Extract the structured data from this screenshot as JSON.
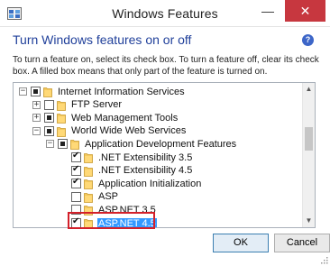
{
  "window": {
    "title": "Windows Features",
    "minimize_glyph": "—",
    "close_glyph": "✕"
  },
  "heading": "Turn Windows features on or off",
  "description": "To turn a feature on, select its check box. To turn a feature off, clear its check box. A filled box means that only part of the feature is turned on.",
  "tree": {
    "items": [
      {
        "label": "Internet Information Services",
        "expander": "−",
        "state": "partial",
        "level": 0
      },
      {
        "label": "FTP Server",
        "expander": "+",
        "state": "unchecked",
        "level": 1
      },
      {
        "label": "Web Management Tools",
        "expander": "+",
        "state": "partial",
        "level": 1
      },
      {
        "label": "World Wide Web Services",
        "expander": "−",
        "state": "partial",
        "level": 1
      },
      {
        "label": "Application Development Features",
        "expander": "−",
        "state": "partial",
        "level": 2
      },
      {
        "label": ".NET Extensibility 3.5",
        "expander": "",
        "state": "checked",
        "level": 3
      },
      {
        "label": ".NET Extensibility 4.5",
        "expander": "",
        "state": "checked",
        "level": 3
      },
      {
        "label": "Application Initialization",
        "expander": "",
        "state": "checked",
        "level": 3
      },
      {
        "label": "ASP",
        "expander": "",
        "state": "unchecked",
        "level": 3
      },
      {
        "label": "ASP.NET 3.5",
        "expander": "",
        "state": "unchecked",
        "level": 3
      },
      {
        "label": "ASP.NET 4.5",
        "expander": "",
        "state": "checked",
        "level": 3,
        "selected": true
      }
    ]
  },
  "scrollbar": {
    "up_glyph": "▲",
    "down_glyph": "▼"
  },
  "buttons": {
    "ok": "OK",
    "cancel": "Cancel"
  },
  "help_glyph": "?",
  "colors": {
    "heading": "#1f3f9a",
    "close_button": "#c7373f",
    "selection": "#3399ff",
    "highlight_border": "#d3202a"
  }
}
